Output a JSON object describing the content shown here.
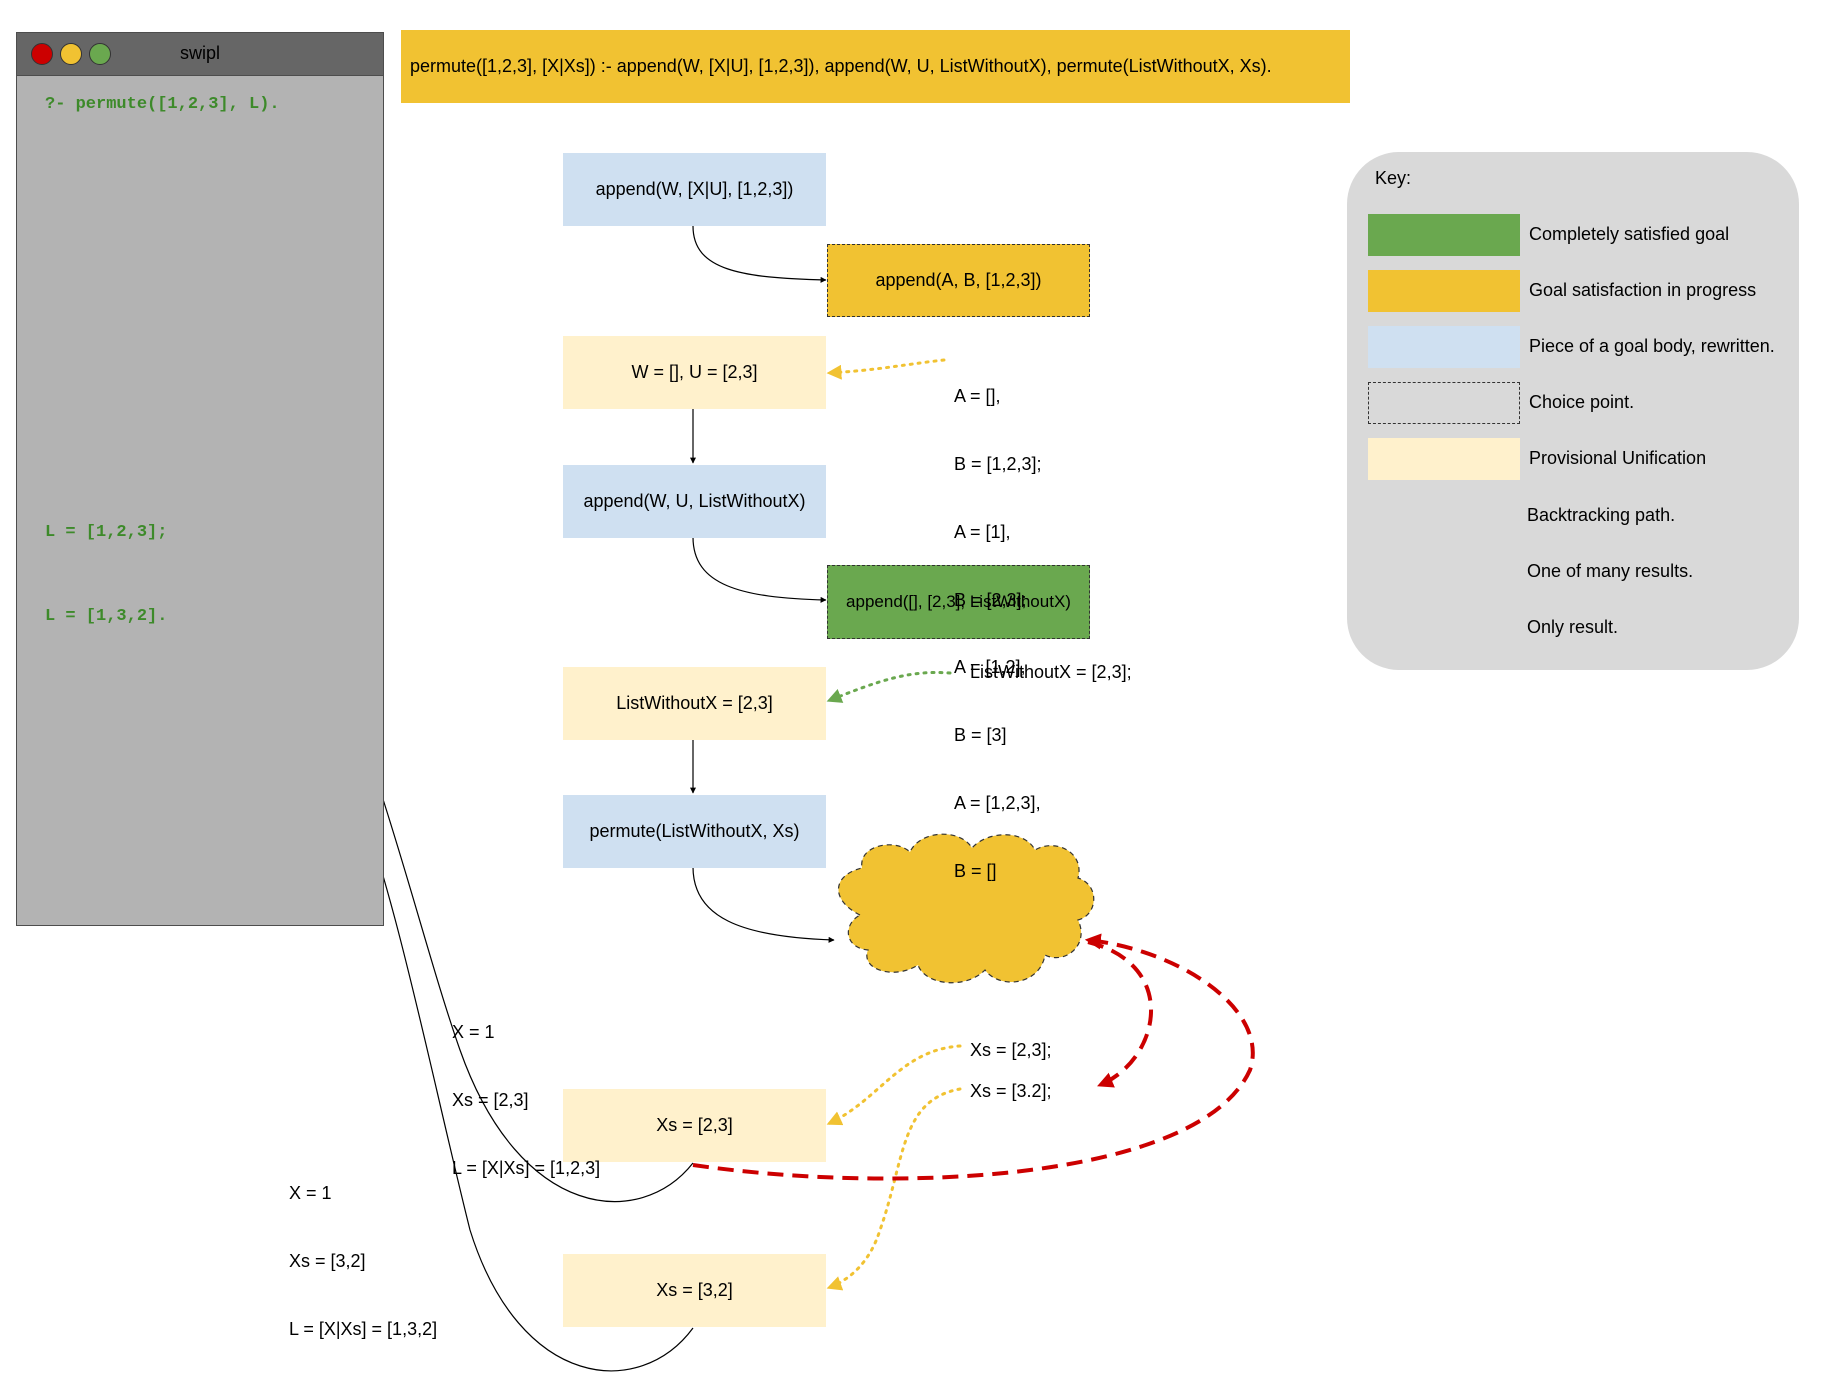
{
  "terminal": {
    "title": "swipl",
    "query": "?- permute([1,2,3], L).",
    "result1": "L = [1,2,3];",
    "result2": "L = [1,3,2]."
  },
  "rule": "permute([1,2,3], [X|Xs]) :- append(W, [X|U], [1,2,3]), append(W, U, ListWithoutX), permute(ListWithoutX, Xs).",
  "boxes": {
    "append1": "append(W, [X|U], [1,2,3])",
    "choice_append": "append(A, B, [1,2,3])",
    "unify_wu": "W = [], U = [2,3]",
    "append2": "append(W, U, ListWithoutX)",
    "satisfied_append": "append([], [2,3], ListWithoutX)",
    "unify_lwx": "ListWithoutX = [2,3]",
    "permute_call": "permute(ListWithoutX, Xs)",
    "xs_1": "Xs = [2,3]",
    "xs_2": "Xs = [3,2]"
  },
  "annotations": {
    "append_results": [
      "A = [],",
      "B = [1,2,3];",
      "A = [1],",
      "B = [2,3];",
      "A = [1,2],",
      "B = [3]",
      "A = [1,2,3],",
      "B = []"
    ],
    "lwx_result": "ListWithoutX = [2,3];",
    "xs_result_1": "Xs = [2,3];",
    "xs_result_2": "Xs = [3.2];",
    "solution1": [
      "X = 1",
      "Xs = [2,3]",
      "L = [X|Xs] = [1,2,3]"
    ],
    "solution2": [
      "X = 1",
      "Xs = [3,2]",
      "L = [X|Xs] = [1,3,2]"
    ]
  },
  "key": {
    "title": "Key:",
    "items": [
      {
        "label": "Completely satisfied goal",
        "swatch": "green"
      },
      {
        "label": "Goal satisfaction in progress",
        "swatch": "yellow"
      },
      {
        "label": "Piece of a goal body, rewritten.",
        "swatch": "blue"
      },
      {
        "label": "Choice point.",
        "swatch": "dashed"
      },
      {
        "label": "Provisional Unification",
        "swatch": "cream"
      },
      {
        "label": "Backtracking path.",
        "swatch": "red-arrow"
      },
      {
        "label": "One of many results.",
        "swatch": "yellow-arrow"
      },
      {
        "label": "Only result.",
        "swatch": "green-arrow"
      }
    ]
  },
  "colors": {
    "satisfied": "#6aa84f",
    "in_progress": "#f1c232",
    "rewritten": "#cfe0f1",
    "provisional": "#fff1cc",
    "backtrack": "#cc0000",
    "terminal_text": "#3d8a2a"
  }
}
